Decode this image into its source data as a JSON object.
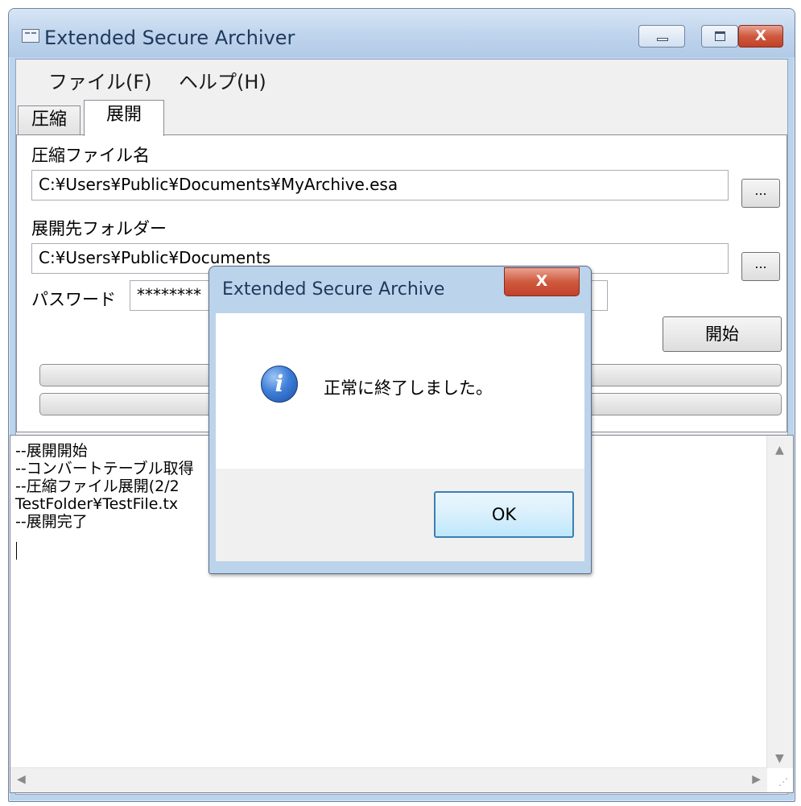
{
  "window": {
    "title": "Extended Secure Archiver",
    "close_glyph": "X"
  },
  "menu": {
    "file": "ファイル(F)",
    "help": "ヘルプ(H)"
  },
  "tabs": [
    {
      "label": "圧縮",
      "active": false
    },
    {
      "label": "展開",
      "active": true
    }
  ],
  "form": {
    "archive_label": "圧縮ファイル名",
    "archive_value": "C:¥Users¥Public¥Documents¥MyArchive.esa",
    "browse_label": "...",
    "dest_label": "展開先フォルダー",
    "dest_value": "C:¥Users¥Public¥Documents",
    "password_label": "パスワード",
    "password_value": "********",
    "start_button": "開始"
  },
  "log": {
    "lines": [
      "--展開開始",
      "--コンバートテーブル取得",
      "--圧縮ファイル展開(2/2",
      "TestFolder¥TestFile.tx",
      "--展開完了"
    ]
  },
  "dialog": {
    "title": "Extended Secure Archive",
    "message": "正常に終了しました。",
    "ok_button": "OK",
    "close_glyph": "X",
    "icon": "information-icon"
  },
  "colors": {
    "frame": "#bcd3ec",
    "close_button": "#c7472d",
    "ok_border": "#3c7fb1"
  }
}
